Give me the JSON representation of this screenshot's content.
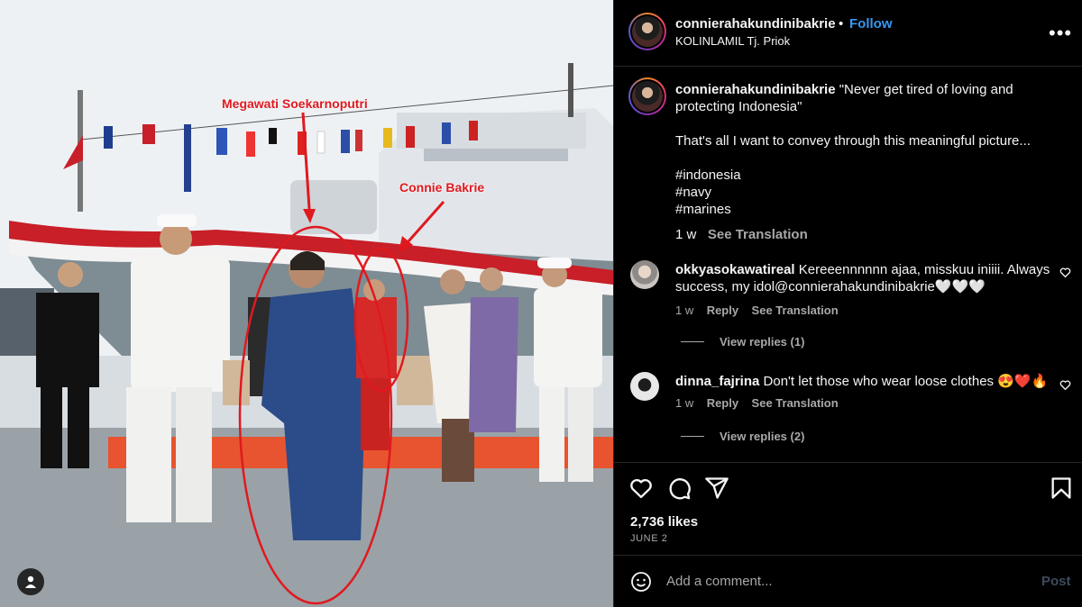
{
  "photo": {
    "annotations": {
      "megawati": "Megawati Soekarnoputri",
      "connie": "Connie Bakrie"
    },
    "icons": [
      "user-icon"
    ]
  },
  "header": {
    "username": "connierahakundinibakrie",
    "separator": "•",
    "follow_label": "Follow",
    "location": "KOLINLAMIL Tj. Priok",
    "more_icon": "more-horizontal-icon"
  },
  "caption": {
    "username": "connierahakundinibakrie",
    "line1": "\"Never get tired of loving and protecting Indonesia\"",
    "line2": "That's all I want to convey through this meaningful picture...",
    "tag1": "#indonesia",
    "tag2": "#navy",
    "tag3": "#marines",
    "time": "1 w",
    "see_translation": "See Translation"
  },
  "comments": [
    {
      "username": "okkyasokawatireal",
      "text": "Kereeennnnnn ajaa, misskuu iniiii. Always success, my idol@connierahakundinibakrie🤍🤍🤍",
      "time": "1 w",
      "reply": "Reply",
      "see_translation": "See Translation",
      "view_replies": "View replies (1)"
    },
    {
      "username": "dinna_fajrina",
      "text": "Don't let those who wear loose clothes 😍❤️🔥",
      "time": "1 w",
      "reply": "Reply",
      "see_translation": "See Translation",
      "view_replies": "View replies (2)"
    }
  ],
  "actions": {
    "icons": [
      "heart-icon",
      "comment-icon",
      "share-icon",
      "bookmark-icon"
    ],
    "likes": "2,736 likes",
    "date": "JUNE 2"
  },
  "add_comment": {
    "placeholder": "Add a comment...",
    "post_label": "Post"
  },
  "colors": {
    "accent": "#3897f0",
    "annotation_red": "#e0191f",
    "background": "#000000",
    "muted": "#a8a8a8"
  }
}
